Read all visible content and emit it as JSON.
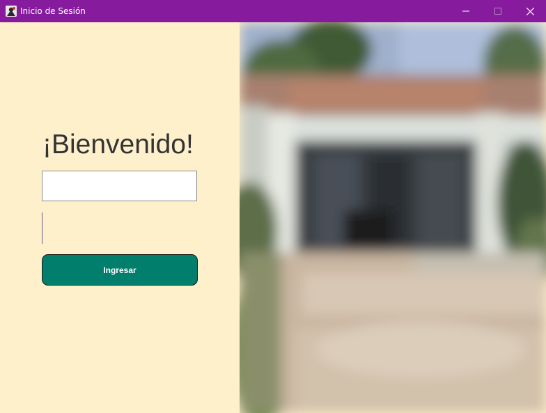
{
  "window": {
    "title": "Inicio de Sesión",
    "icon": "java-app-icon",
    "title_bar_color": "#861b9e",
    "controls": [
      "minimize-icon",
      "maximize-icon",
      "close-icon"
    ]
  },
  "login": {
    "heading": "¡Bienvenido!",
    "username_value": "",
    "password_value": "",
    "submit_label": "Ingresar",
    "panel_color": "#fff0cc",
    "button_color": "#017f6c"
  },
  "photo": {
    "description_icon": "blurred-building-photo"
  }
}
